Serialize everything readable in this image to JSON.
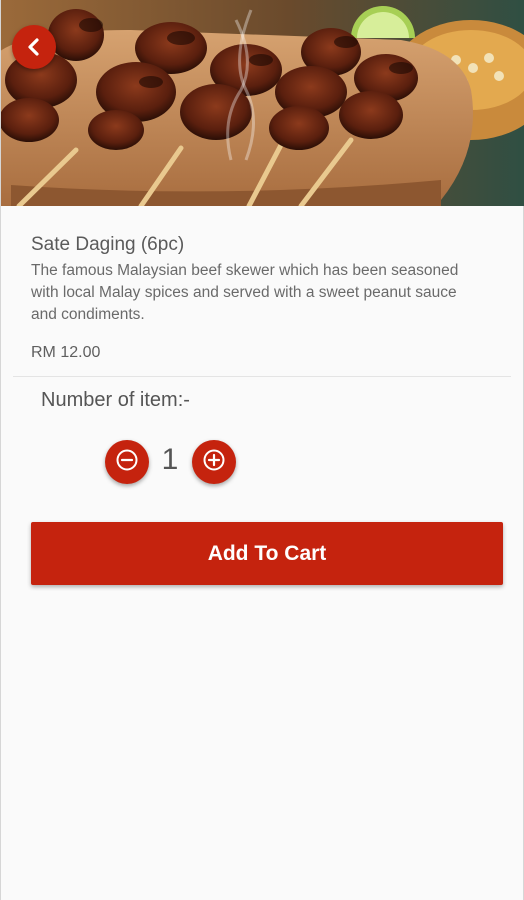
{
  "product": {
    "name": "Sate Daging (6pc)",
    "description": "The famous Malaysian beef skewer which has been seasoned with local Malay spices and served with a sweet peanut sauce and condiments.",
    "price": "RM 12.00"
  },
  "quantity": {
    "label": "Number of item:-",
    "value": "1"
  },
  "actions": {
    "add_to_cart_label": "Add To Cart"
  },
  "icons": {
    "back": "chevron-left-icon",
    "decrement": "minus-circle-icon",
    "increment": "plus-circle-icon"
  },
  "colors": {
    "accent": "#c5230e",
    "background": "#fafafa",
    "text": "#5a5a5a"
  }
}
